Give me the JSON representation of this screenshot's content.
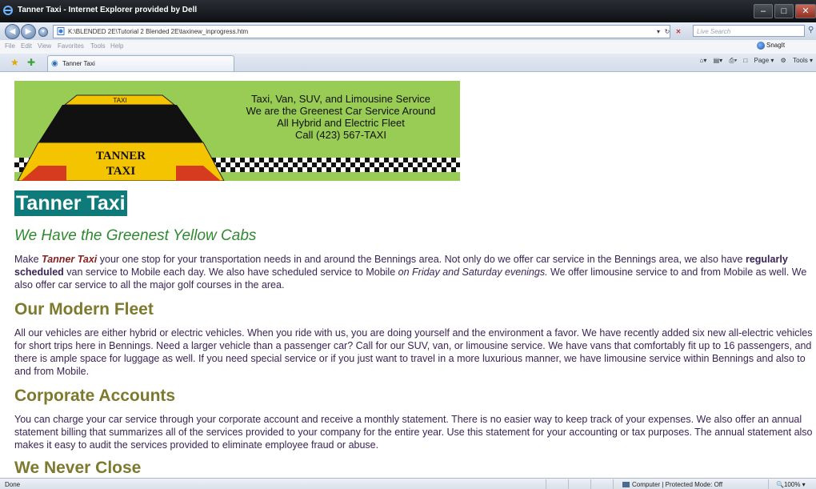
{
  "window": {
    "title": "Tanner Taxi - Internet Explorer provided by Dell"
  },
  "address": {
    "url": "K:\\BLENDED 2E\\Tutorial 2 Blended 2E\\taxinew_inprogress.htm",
    "search_placeholder": "Live Search"
  },
  "menu": {
    "items": [
      "File",
      "Edit",
      "View",
      "Favorites",
      "Tools",
      "Help"
    ],
    "snagit": "SnagIt"
  },
  "tab": {
    "label": "Tanner Taxi"
  },
  "toolbar": {
    "page": "Page",
    "tools": "Tools"
  },
  "banner": {
    "taxi_sign": "TAXI",
    "car_text_line1": "TANNER",
    "car_text_line2": "TAXI",
    "lines": [
      "Taxi, Van, SUV, and Limousine Service",
      "We are the Greenest Car Service Around",
      "All Hybrid and Electric Fleet",
      "Call (423) 567-TAXI"
    ]
  },
  "page": {
    "heading": "Tanner Taxi",
    "slogan": "We Have the Greenest Yellow Cabs",
    "intro": {
      "t1": "Make ",
      "name": "Tanner Taxi",
      "t2": " your one stop for your transportation needs in and around the Bennings area. Not only do we offer car service in the Bennings area, we also have ",
      "bold": "regularly scheduled",
      "t3": " van service to Mobile each day. We also have scheduled service to Mobile ",
      "italic": "on Friday and Saturday evenings.",
      "t4": " We offer limousine service to and from Mobile as well. We also offer car service to all the major golf courses in the area."
    },
    "fleet_heading": "Our Modern Fleet",
    "fleet_text": "All our vehicles are either hybrid or electric vehicles. When you ride with us, you are doing yourself and the environment a favor. We have recently added six new all-electric vehicles for short trips here in Bennings. Need a larger vehicle than a passenger car? Call for our SUV, van, or limousine service. We have vans that comfortably fit up to 16 passengers, and there is ample space for luggage as well. If you need special service or if you just want to travel in a more luxurious manner, we have limousine service within Bennings and also to and from Mobile.",
    "corp_heading": "Corporate Accounts",
    "corp_text": "You can charge your car service through your corporate account and receive a monthly statement. There is no easier way to keep track of your expenses. We also offer an annual statement billing that summarizes all of the services provided to your company for the entire year. Use this statement for your accounting or tax purposes. The annual statement also makes it easy to audit the services provided to eliminate employee fraud or abuse.",
    "partial_heading": "We Never Close"
  },
  "status": {
    "left": "Done",
    "zone": "Computer | Protected Mode: Off",
    "zoom": "100%"
  }
}
